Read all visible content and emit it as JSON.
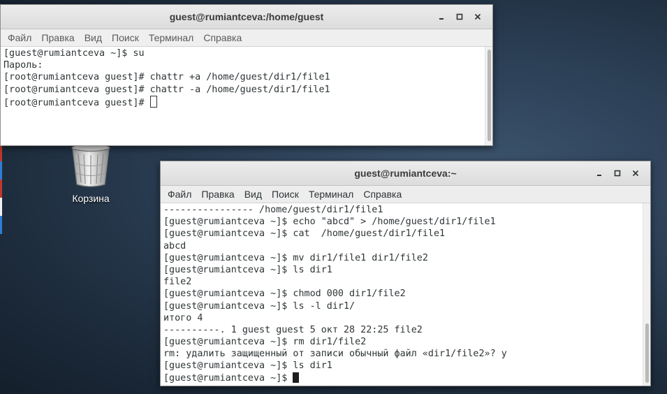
{
  "desktop": {
    "trash_label": "Корзина"
  },
  "window_top": {
    "title": "guest@rumiantceva:/home/guest",
    "menu": [
      "Файл",
      "Правка",
      "Вид",
      "Поиск",
      "Терминал",
      "Справка"
    ],
    "lines": [
      "[guest@rumiantceva ~]$ su",
      "Пароль:",
      "[root@rumiantceva guest]# chattr +a /home/guest/dir1/file1",
      "[root@rumiantceva guest]# chattr -a /home/guest/dir1/file1",
      "[root@rumiantceva guest]#"
    ]
  },
  "window_bottom": {
    "title": "guest@rumiantceva:~",
    "menu": [
      "Файл",
      "Правка",
      "Вид",
      "Поиск",
      "Терминал",
      "Справка"
    ],
    "lines": [
      "---------------- /home/guest/dir1/file1",
      "[guest@rumiantceva ~]$ echo \"abcd\" > /home/guest/dir1/file1",
      "[guest@rumiantceva ~]$ cat  /home/guest/dir1/file1",
      "abcd",
      "[guest@rumiantceva ~]$ mv dir1/file1 dir1/file2",
      "[guest@rumiantceva ~]$ ls dir1",
      "file2",
      "[guest@rumiantceva ~]$ chmod 000 dir1/file2",
      "[guest@rumiantceva ~]$ ls -l dir1/",
      "итого 4",
      "----------. 1 guest guest 5 окт 28 22:25 file2",
      "[guest@rumiantceva ~]$ rm dir1/file2",
      "rm: удалить защищенный от записи обычный файл «dir1/file2»? y",
      "[guest@rumiantceva ~]$ ls dir1",
      "[guest@rumiantceva ~]$"
    ]
  },
  "icons": {
    "minimize": "minimize-icon",
    "maximize": "maximize-icon",
    "close": "close-icon",
    "trash": "trash-icon"
  }
}
